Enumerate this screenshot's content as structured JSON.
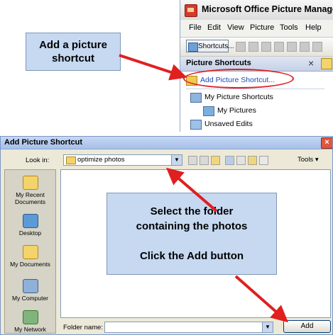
{
  "picture_manager": {
    "title": "Microsoft Office Picture Manager",
    "menu": [
      "File",
      "Edit",
      "View",
      "Picture",
      "Tools",
      "Help"
    ],
    "shortcuts_button": "Shortcuts...",
    "pane_title": "Picture Shortcuts",
    "pane_close": "×",
    "add_shortcut_link": "Add Picture Shortcut...",
    "items": [
      {
        "label": "My Picture Shortcuts",
        "icon": "shortcuts-folder-icon"
      },
      {
        "label": "My Pictures",
        "icon": "pictures-folder-icon"
      },
      {
        "label": "Unsaved Edits",
        "icon": "edits-icon"
      }
    ]
  },
  "callouts": {
    "first": [
      "Add a picture",
      "shortcut"
    ],
    "second": [
      "Select the folder",
      "containing the photos",
      "Click the Add button"
    ]
  },
  "dialog": {
    "title": "Add Picture Shortcut",
    "close": "×",
    "look_in_label": "Look in:",
    "look_in_value": "optimize photos",
    "tools_label": "Tools ▾",
    "places": [
      "My Recent Documents",
      "Desktop",
      "My Documents",
      "My Computer",
      "My Network"
    ],
    "folder_name_label": "Folder name:",
    "folder_name_value": "",
    "add_button": "Add"
  },
  "colors": {
    "callout_fill": "#c6d9f1",
    "arrow": "#e01f1f",
    "link": "#1b4bb5"
  }
}
